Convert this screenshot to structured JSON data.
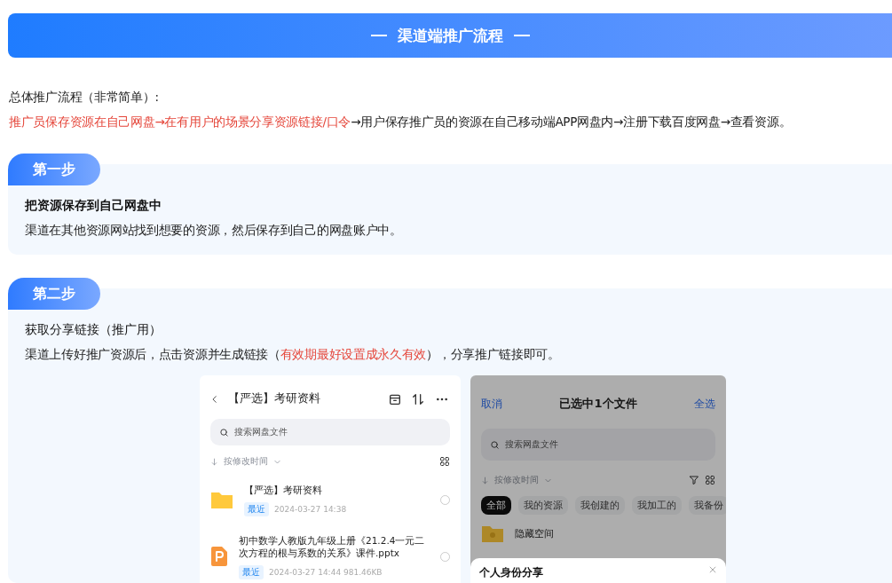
{
  "banner": {
    "title": "渠道端推广流程"
  },
  "intro": {
    "heading": "总体推广流程（非常简单）:",
    "flow": [
      {
        "text": "推广员保存资源在自己网盘→在有用户的场景分享资源链接/口令",
        "highlight": true
      },
      {
        "text": "→用户保存推广员的资源在自己移动端APP网盘内→注册下载百度网盘→查看资源。",
        "highlight": false
      }
    ]
  },
  "steps": [
    {
      "badge": "第一步",
      "title": "把资源保存到自己网盘中",
      "title_bold": true,
      "desc": [
        {
          "text": "渠道在其他资源网站找到想要的资源，然后保存到自己的网盘账户中。",
          "highlight": false
        }
      ]
    },
    {
      "badge": "第二步",
      "title": "获取分享链接（推广用）",
      "title_bold": false,
      "desc": [
        {
          "text": "渠道上传好推广资源后，点击资源并生成链接（",
          "highlight": false
        },
        {
          "text": "有效期最好设置成永久有效",
          "highlight": true
        },
        {
          "text": "），分享推广链接即可。",
          "highlight": false
        }
      ],
      "phones": [
        {
          "dimmed": false,
          "header": {
            "kind": "folder",
            "title": "【严选】考研资料"
          },
          "search": {
            "placeholder": "搜索网盘文件"
          },
          "sort": "按修改时间",
          "files": [
            {
              "kind": "folder",
              "name": "【严选】考研资料",
              "tag": "最近",
              "date": "2024-03-27  14:38",
              "selected": false
            },
            {
              "kind": "pptx",
              "name": "初中数学人教版九年级上册《21.2.4一元二次方程的根与系数的关系》课件.pptx",
              "tag": "最近",
              "date": "2024-03-27  14:44  981.46KB",
              "selected": false
            }
          ]
        },
        {
          "dimmed": true,
          "header": {
            "kind": "select",
            "cancel": "取消",
            "title": "已选中1个文件",
            "select_all": "全选"
          },
          "search": {
            "placeholder": "搜索网盘文件"
          },
          "sort": "按修改时间",
          "filters": [
            {
              "label": "全部",
              "selected": true
            },
            {
              "label": "我的资源",
              "selected": false
            },
            {
              "label": "我创建的",
              "selected": false
            },
            {
              "label": "我加工的",
              "selected": false
            },
            {
              "label": "我备份",
              "selected": false
            }
          ],
          "files": [
            {
              "kind": "locked-folder",
              "name": "隐藏空间"
            }
          ],
          "sheet": {
            "title": "个人身份分享"
          }
        }
      ]
    }
  ]
}
